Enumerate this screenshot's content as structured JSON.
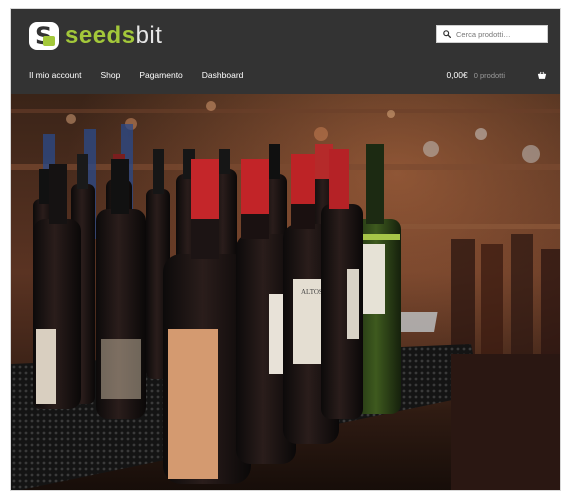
{
  "brand": {
    "name_part1": "seeds",
    "name_part2": "bit",
    "colors": {
      "accent": "#a3c83a",
      "header_bg": "#333333"
    }
  },
  "search": {
    "placeholder": "Cerca prodotti…",
    "icon": "search-icon"
  },
  "nav": {
    "items": [
      "Il mio account",
      "Shop",
      "Pagamento",
      "Dashboard"
    ]
  },
  "cart": {
    "total": "0,00€",
    "count_label": "0 prodotti",
    "icon": "basket-icon"
  },
  "hero": {
    "image": "wine-bottles-bar-photo",
    "description_visible_text": [
      "ALTOS"
    ]
  }
}
